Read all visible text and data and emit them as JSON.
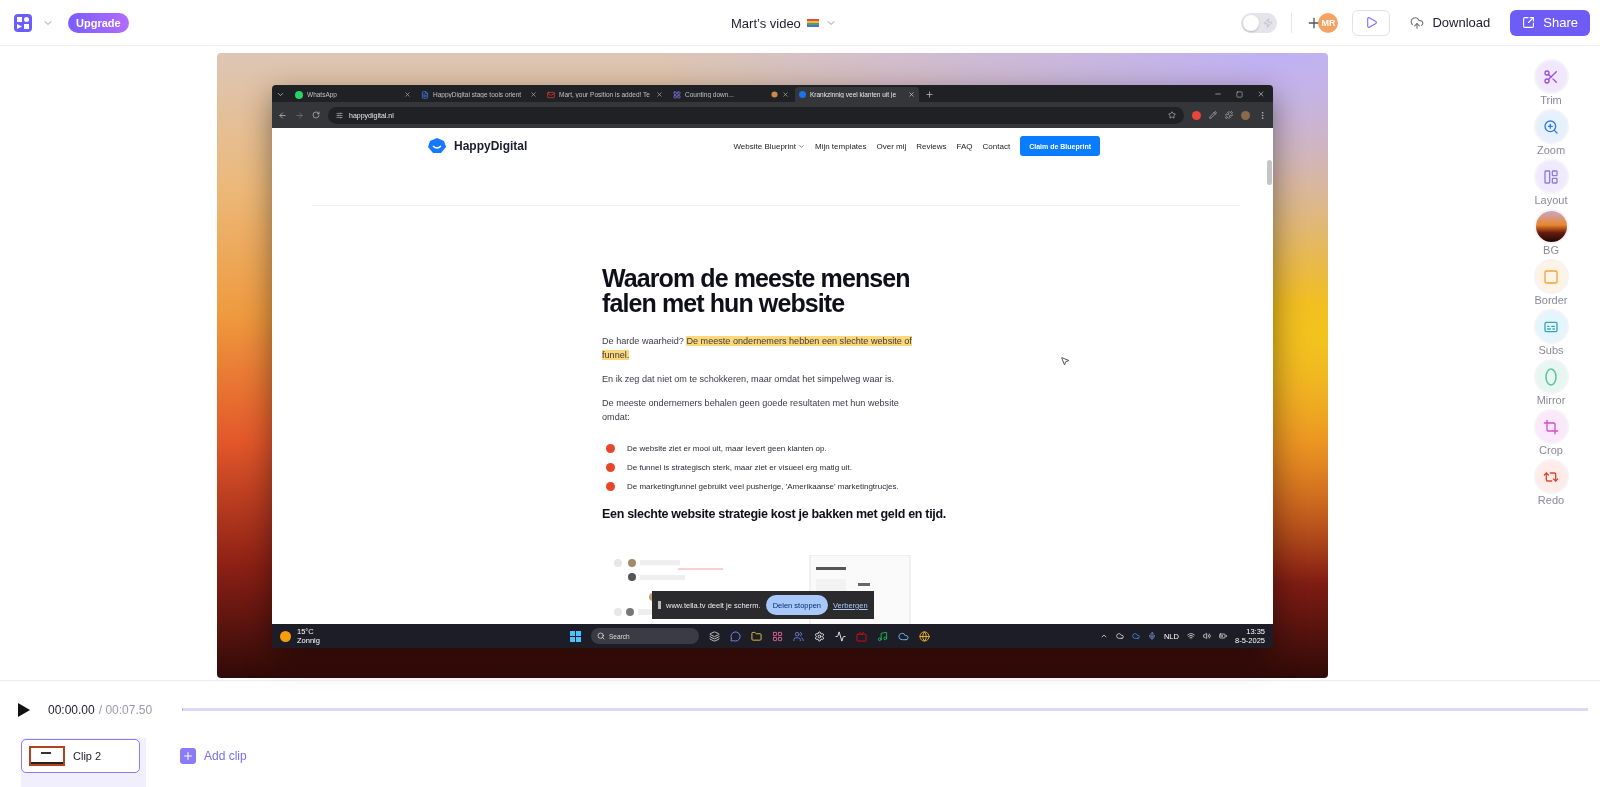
{
  "header": {
    "upgrade": "Upgrade",
    "title": "Mart’s video",
    "toggle": {
      "on": false
    },
    "avatar": "MR",
    "download": "Download",
    "share": "Share"
  },
  "recording": {
    "tabs": [
      {
        "label": "WhatsApp",
        "kind": "chat",
        "selected": false
      },
      {
        "label": "HappyDigital stage tools orient",
        "kind": "doc",
        "selected": false
      },
      {
        "label": "Mart, your Position is added! Te",
        "kind": "mail",
        "selected": false
      },
      {
        "label": "Counting down...",
        "kind": "grid",
        "selected": false
      },
      {
        "label": "Krankzinnig veel klanten uit je",
        "kind": "site",
        "selected": true
      }
    ],
    "url": "happydigital.nl",
    "site": {
      "brand": "HappyDigital",
      "nav": [
        {
          "label": "Website Blueprint",
          "dropdown": true
        },
        {
          "label": "Mijn templates",
          "dropdown": false
        },
        {
          "label": "Over mij",
          "dropdown": false
        },
        {
          "label": "Reviews",
          "dropdown": false
        },
        {
          "label": "FAQ",
          "dropdown": false
        },
        {
          "label": "Contact",
          "dropdown": false
        }
      ],
      "cta": "Claim de Blueprint",
      "heading": "Waarom de meeste mensen falen met hun website",
      "intro": "De harde waarheid?",
      "highlight": "De meeste ondernemers hebben een slechte website of funnel.",
      "paragraphs": [
        "En ik zeg dat niet om te schokkeren, maar omdat het simpelweg waar is.",
        "De meeste ondernemers behalen geen goede resultaten met hun website omdat:"
      ],
      "bullets": [
        "De website ziet er mooi uit, maar levert geen klanten op.",
        "De funnel is strategisch sterk, maar ziet er visueel erg matig uit.",
        "De marketingfunnel gebruikt veel pusherige, 'Amerikaanse' marketingtrucjes."
      ],
      "subheading": "Een slechte website strategie kost je bakken met geld en tijd."
    },
    "share_banner": {
      "message": "www.tella.tv deelt je scherm.",
      "stop": "Delen stoppen",
      "hide": "Verbergen"
    },
    "taskbar": {
      "temperature": "15°C",
      "weather": "Zonnig",
      "search": {
        "placeholder": "Search"
      },
      "language": "NLD",
      "time": "13:35",
      "date": "8-5-2025"
    }
  },
  "tools": [
    {
      "label": "Trim",
      "kind": "trim"
    },
    {
      "label": "Zoom",
      "kind": "zoom"
    },
    {
      "label": "Layout",
      "kind": "layout"
    },
    {
      "label": "BG",
      "kind": "bg"
    },
    {
      "label": "Border",
      "kind": "border"
    },
    {
      "label": "Subs",
      "kind": "subs"
    },
    {
      "label": "Mirror",
      "kind": "mirror"
    },
    {
      "label": "Crop",
      "kind": "crop"
    },
    {
      "label": "Redo",
      "kind": "redo"
    }
  ],
  "player": {
    "current": "00:00.00",
    "total": "/ 00:07.50"
  },
  "clips": [
    {
      "label": "Clip 2",
      "selected": true
    }
  ],
  "add_clip": "Add clip"
}
